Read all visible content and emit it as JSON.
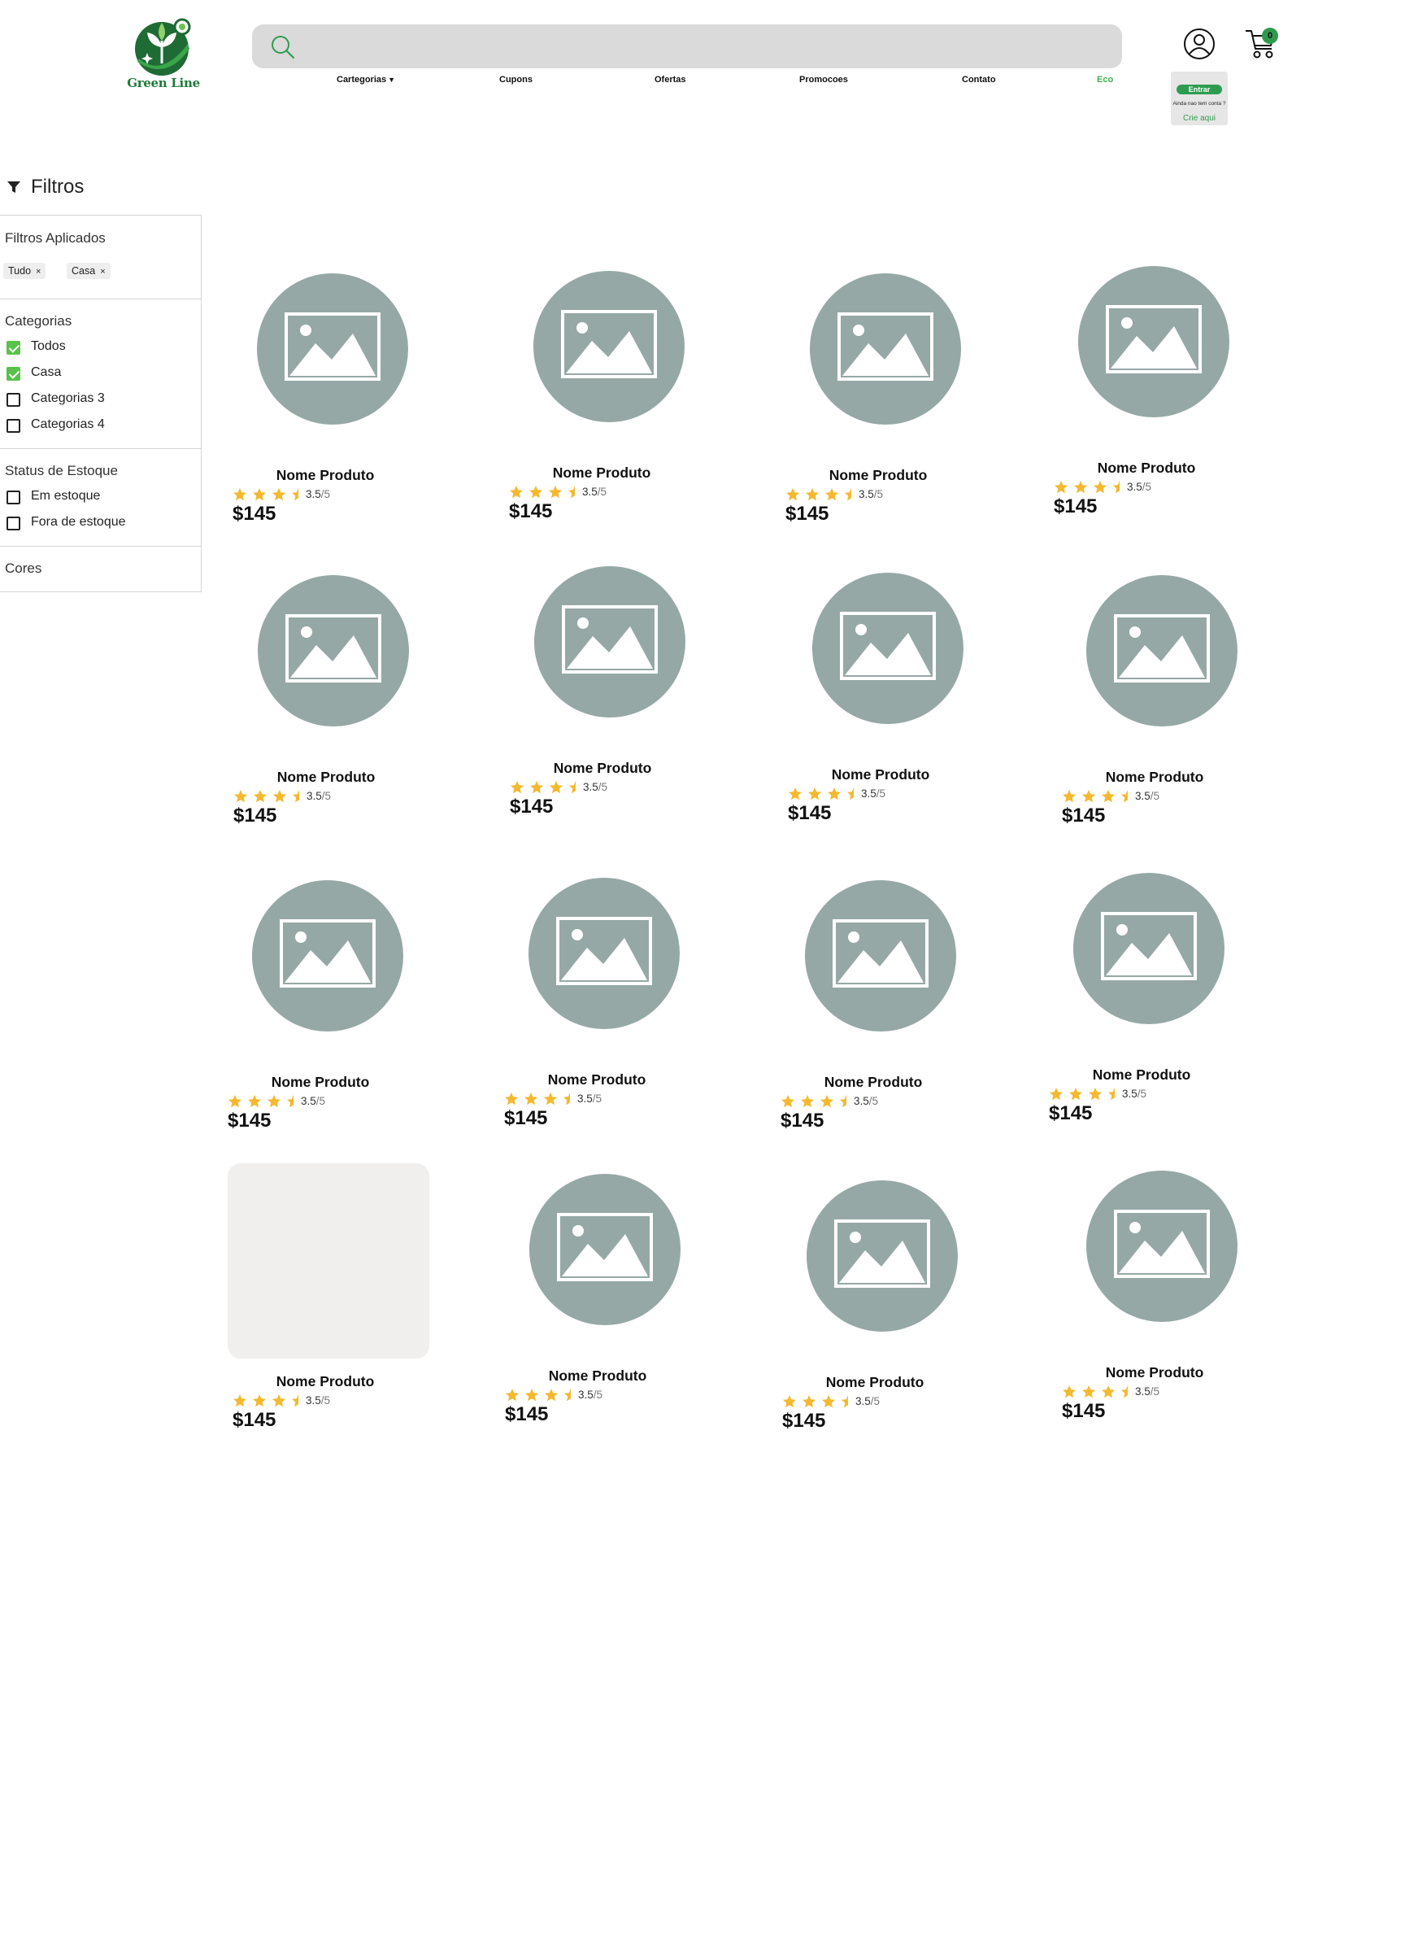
{
  "brand": {
    "name": "Green Line"
  },
  "search": {
    "placeholder": "",
    "value": ""
  },
  "nav": {
    "items": [
      {
        "label": "Cartegorias",
        "has_caret": true
      },
      {
        "label": "Cupons"
      },
      {
        "label": "Ofertas"
      },
      {
        "label": "Promocoes"
      },
      {
        "label": "Contato"
      },
      {
        "label": "Eco",
        "highlight": true
      }
    ]
  },
  "cart": {
    "count": "0"
  },
  "account": {
    "login_label": "Entrar",
    "signup_note": "Ainda nao tem conta ?",
    "signup_link": "Crie aqui"
  },
  "filters": {
    "title": "Filtros",
    "applied_label": "Filtros Aplicados",
    "applied": [
      {
        "label": "Tudo",
        "remove": "×"
      },
      {
        "label": "Casa",
        "remove": "×"
      }
    ],
    "categories_label": "Categorias",
    "categories": [
      {
        "label": "Todos",
        "checked": true
      },
      {
        "label": "Casa",
        "checked": true
      },
      {
        "label": "Categorias 3",
        "checked": false
      },
      {
        "label": "Categorias 4",
        "checked": false
      }
    ],
    "stock_label": "Status de Estoque",
    "stock": [
      {
        "label": "Em estoque",
        "checked": false
      },
      {
        "label": "Fora de estoque",
        "checked": false
      }
    ],
    "colors_label": "Cores"
  },
  "products": [
    {
      "name": "Nome Produto",
      "rating": "3.5",
      "rating_max": "/5",
      "stars": 3.5,
      "price": "$145",
      "image": "image-placeholder-icon"
    },
    {
      "name": "Nome Produto",
      "rating": "3.5",
      "rating_max": "/5",
      "stars": 3.5,
      "price": "$145",
      "image": "image-placeholder-icon"
    },
    {
      "name": "Nome Produto",
      "rating": "3.5",
      "rating_max": "/5",
      "stars": 3.5,
      "price": "$145",
      "image": "image-placeholder-icon"
    },
    {
      "name": "Nome Produto",
      "rating": "3.5",
      "rating_max": "/5",
      "stars": 3.5,
      "price": "$145",
      "image": "image-placeholder-icon"
    },
    {
      "name": "Nome Produto",
      "rating": "3.5",
      "rating_max": "/5",
      "stars": 3.5,
      "price": "$145",
      "image": "image-placeholder-icon"
    },
    {
      "name": "Nome Produto",
      "rating": "3.5",
      "rating_max": "/5",
      "stars": 3.5,
      "price": "$145",
      "image": "image-placeholder-icon"
    },
    {
      "name": "Nome Produto",
      "rating": "3.5",
      "rating_max": "/5",
      "stars": 3.5,
      "price": "$145",
      "image": "image-placeholder-icon"
    },
    {
      "name": "Nome Produto",
      "rating": "3.5",
      "rating_max": "/5",
      "stars": 3.5,
      "price": "$145",
      "image": "image-placeholder-icon"
    },
    {
      "name": "Nome Produto",
      "rating": "3.5",
      "rating_max": "/5",
      "stars": 3.5,
      "price": "$145",
      "image": "image-placeholder-icon"
    },
    {
      "name": "Nome Produto",
      "rating": "3.5",
      "rating_max": "/5",
      "stars": 3.5,
      "price": "$145",
      "image": "image-placeholder-icon"
    },
    {
      "name": "Nome Produto",
      "rating": "3.5",
      "rating_max": "/5",
      "stars": 3.5,
      "price": "$145",
      "image": "image-placeholder-icon"
    },
    {
      "name": "Nome Produto",
      "rating": "3.5",
      "rating_max": "/5",
      "stars": 3.5,
      "price": "$145",
      "image": "image-placeholder-icon"
    },
    {
      "name": "Nome Produto",
      "rating": "3.5",
      "rating_max": "/5",
      "stars": 3.5,
      "price": "$145",
      "image": "blank"
    },
    {
      "name": "Nome Produto",
      "rating": "3.5",
      "rating_max": "/5",
      "stars": 3.5,
      "price": "$145",
      "image": "image-placeholder-icon"
    },
    {
      "name": "Nome Produto",
      "rating": "3.5",
      "rating_max": "/5",
      "stars": 3.5,
      "price": "$145",
      "image": "image-placeholder-icon"
    },
    {
      "name": "Nome Produto",
      "rating": "3.5",
      "rating_max": "/5",
      "stars": 3.5,
      "price": "$145",
      "image": "image-placeholder-icon"
    }
  ],
  "colors": {
    "brand_green": "#2e9c4f",
    "check_green": "#58c24c",
    "star": "#f5b82e",
    "image_placeholder": "#96a8a6"
  }
}
